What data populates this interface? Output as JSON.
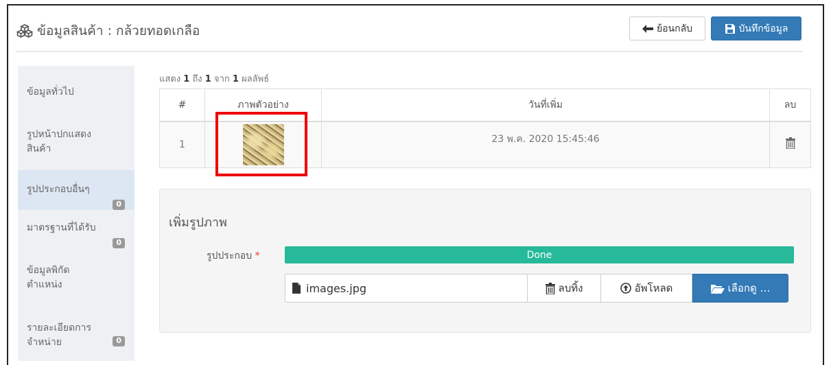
{
  "header": {
    "title": "ข้อมูลสินค้า : กล้วยทอดเกลือ",
    "back_label": "ย้อนกลับ",
    "save_label": "บันทึกข้อมูล",
    "title_icon": "cubes-icon",
    "back_icon": "arrow-left-icon",
    "save_icon": "save-icon"
  },
  "sidebar": {
    "items": [
      {
        "label": "ข้อมูลทั่วไป"
      },
      {
        "label_line1": "รูปหน้าปกแสดง",
        "label_line2": "สินค้า"
      },
      {
        "label": "รูปประกอบอื่นๆ",
        "badge": "0",
        "active": true
      },
      {
        "label": "มาตรฐานที่ได้รับ",
        "badge": "0"
      },
      {
        "label_line1": "ข้อมูลพิกัด",
        "label_line2": "ตำแหน่ง"
      },
      {
        "label_line1": "รายละเอียดการ",
        "label_line2": "จำหน่าย",
        "badge": "0"
      }
    ]
  },
  "results": {
    "prefix": "แสดง",
    "from": "1",
    "to_word": "ถึง",
    "to": "1",
    "of_word": "จาก",
    "total": "1",
    "suffix": "ผลลัพธ์"
  },
  "table": {
    "headers": [
      "#",
      "ภาพตัวอย่าง",
      "วันที่เพิ่ม",
      "ลบ"
    ],
    "rows": [
      {
        "index": "1",
        "date_added": "23 พ.ค. 2020 15:45:46",
        "delete_icon": "trash-icon"
      }
    ]
  },
  "upload": {
    "title": "เพิ่มรูปภาพ",
    "field_label": "รูปประกอบ",
    "required_mark": "*",
    "progress_text": "Done",
    "progress_value": 1.0,
    "file_name": "images.jpg",
    "clear_label": "ลบทิ้ง",
    "upload_label": "อัพโหลด",
    "browse_label": "เลือกดู …"
  },
  "colors": {
    "primary": "#337ab7",
    "progress": "#26b99a",
    "highlight": "#ee0000",
    "badge": "#999999"
  }
}
